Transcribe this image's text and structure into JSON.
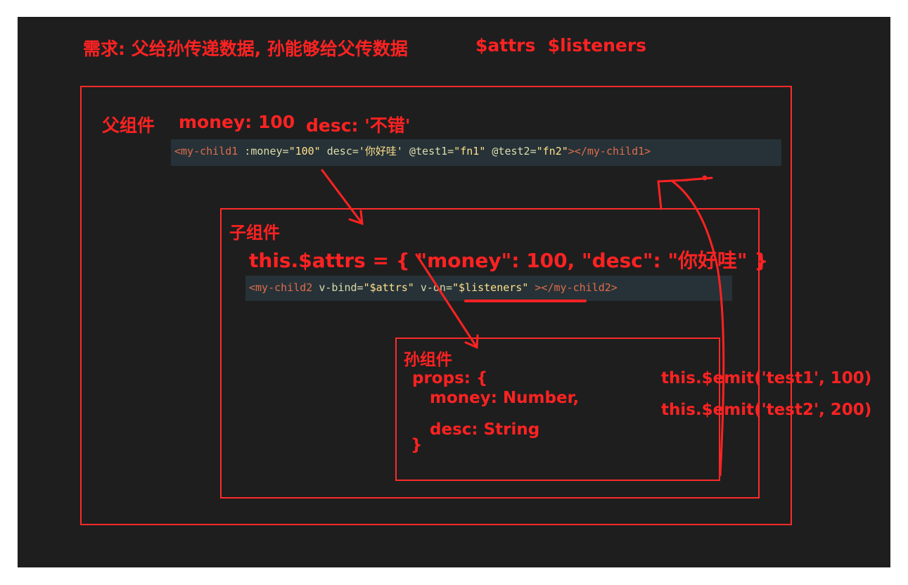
{
  "requirement": {
    "title": "需求: 父给孙传递数据, 孙能够给父传数据",
    "apis": "$attrs  $listeners"
  },
  "parent": {
    "label": "父组件",
    "money": "money: 100",
    "desc": "desc: '不错'",
    "code": {
      "open_tag": "<my-child1",
      "money_attr": " :money=",
      "money_val": "\"100\"",
      "desc_attr": " desc=",
      "desc_val": "'你好哇'",
      "test1_attr": " @test1=",
      "test1_val": "\"fn1\"",
      "test2_attr": " @test2=",
      "test2_val": "\"fn2\"",
      "close_tag": "></my-child1>"
    }
  },
  "child": {
    "label": "子组件",
    "attrs_line": "this.$attrs = { \"money\": 100, \"desc\": \"你好哇\" }",
    "code": {
      "open_tag": "<my-child2",
      "bind_attr": " v-bind=",
      "bind_val": "\"$attrs\"",
      "on_attr": " v-on=",
      "on_val": "\"$listeners\"",
      "close_tag": " ></my-child2>"
    }
  },
  "grandchild": {
    "label": "孙组件",
    "props_open": "props: {",
    "prop_money": "money: Number,",
    "prop_desc": "desc: String",
    "props_close": "}"
  },
  "emits": {
    "emit1": "this.$emit('test1', 100)",
    "emit2": "this.$emit('test2', 200)"
  },
  "colors": {
    "annotation": "#ff2222",
    "background": "#1e1e1e",
    "code_bg": "#263238"
  }
}
